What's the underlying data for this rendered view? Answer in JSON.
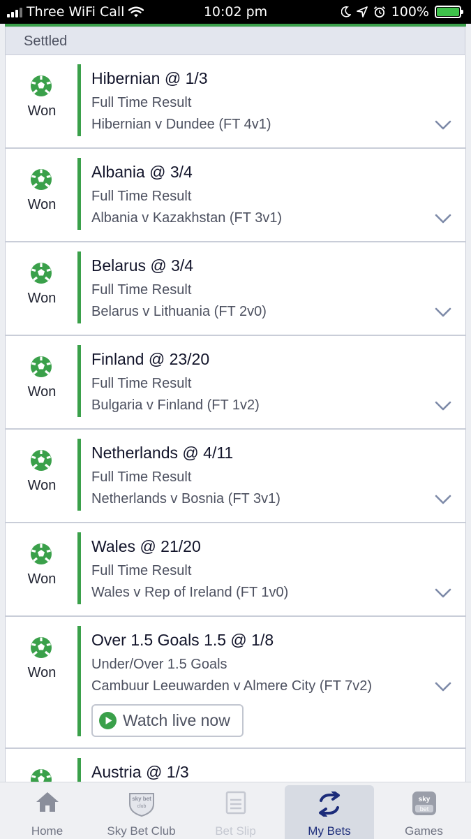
{
  "status_bar": {
    "carrier": "Three WiFi Call",
    "time": "10:02 pm",
    "battery": "100%"
  },
  "section_header": "Settled",
  "bets": [
    {
      "status": "Won",
      "selection": "Hibernian @ 1/3",
      "market": "Full Time Result",
      "event": "Hibernian v Dundee (FT 4v1)"
    },
    {
      "status": "Won",
      "selection": "Albania @ 3/4",
      "market": "Full Time Result",
      "event": "Albania v Kazakhstan (FT 3v1)"
    },
    {
      "status": "Won",
      "selection": "Belarus @ 3/4",
      "market": "Full Time Result",
      "event": "Belarus v Lithuania (FT 2v0)"
    },
    {
      "status": "Won",
      "selection": "Finland @ 23/20",
      "market": "Full Time Result",
      "event": "Bulgaria v Finland (FT 1v2)"
    },
    {
      "status": "Won",
      "selection": "Netherlands @ 4/11",
      "market": "Full Time Result",
      "event": "Netherlands v Bosnia (FT 3v1)"
    },
    {
      "status": "Won",
      "selection": "Wales @ 21/20",
      "market": "Full Time Result",
      "event": "Wales v Rep of Ireland (FT 1v0)"
    },
    {
      "status": "Won",
      "selection": "Over 1.5 Goals 1.5 @ 1/8",
      "market": "Under/Over 1.5 Goals",
      "event": "Cambuur Leeuwarden v Almere City (FT 7v2)",
      "watch_label": "Watch live now"
    },
    {
      "status": "",
      "selection": "Austria @ 1/3",
      "market": "",
      "event": ""
    }
  ],
  "tabs": [
    {
      "label": "Home",
      "icon": "home-icon"
    },
    {
      "label": "Sky Bet Club",
      "icon": "sky-bet-club-icon",
      "badge_text": "sky bet club"
    },
    {
      "label": "Bet Slip",
      "icon": "bet-slip-icon"
    },
    {
      "label": "My Bets",
      "icon": "my-bets-icon"
    },
    {
      "label": "Games",
      "icon": "games-icon",
      "badge_text": "sky bet"
    }
  ],
  "colors": {
    "won_green": "#3aa04a",
    "active_tab": "#1c2c7a",
    "status_bar_bg": "#000000"
  }
}
